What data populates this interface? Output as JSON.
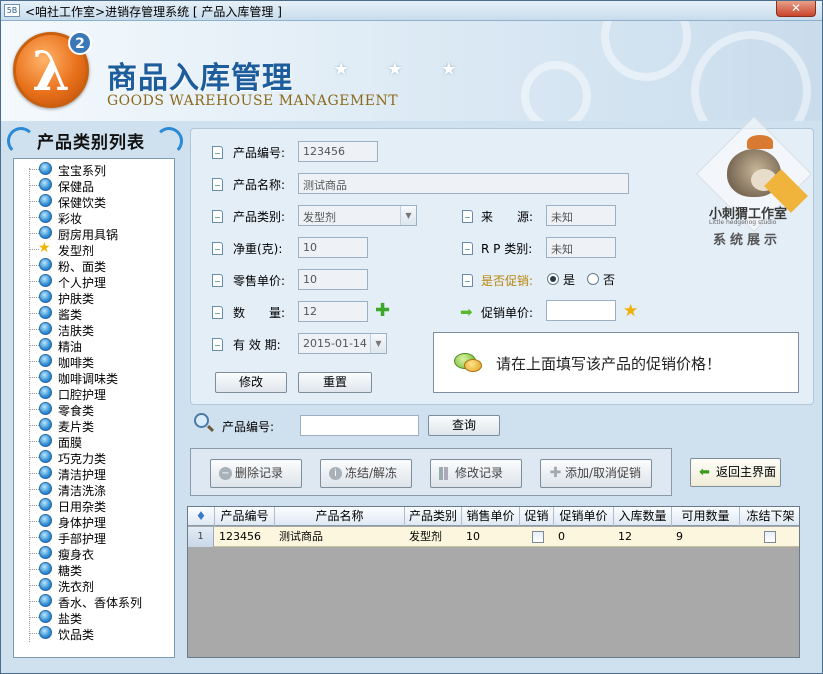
{
  "window": {
    "app_icon_text": "5B",
    "title": "<咱社工作室>进销存管理系统 [ 产品入库管理 ]",
    "close_label": "✕"
  },
  "header": {
    "logo_glyph": "λ",
    "logo_badge": "2",
    "title": "商品入库管理",
    "subtitle": "GOODS WAREHOUSE MANAGEMENT",
    "stars": "★ ★ ★"
  },
  "sidebar": {
    "title": "产品类别列表",
    "items": [
      {
        "label": "宝宝系列",
        "icon": "globe"
      },
      {
        "label": "保健品",
        "icon": "globe"
      },
      {
        "label": "保健饮类",
        "icon": "globe"
      },
      {
        "label": "彩妆",
        "icon": "globe"
      },
      {
        "label": "厨房用具锅",
        "icon": "globe"
      },
      {
        "label": "发型剂",
        "icon": "star"
      },
      {
        "label": "粉、面类",
        "icon": "globe"
      },
      {
        "label": "个人护理",
        "icon": "globe"
      },
      {
        "label": "护肤类",
        "icon": "globe"
      },
      {
        "label": "酱类",
        "icon": "globe"
      },
      {
        "label": "洁肤类",
        "icon": "globe"
      },
      {
        "label": "精油",
        "icon": "globe"
      },
      {
        "label": "咖啡类",
        "icon": "globe"
      },
      {
        "label": "咖啡调味类",
        "icon": "globe"
      },
      {
        "label": "口腔护理",
        "icon": "globe"
      },
      {
        "label": "零食类",
        "icon": "globe"
      },
      {
        "label": "麦片类",
        "icon": "globe"
      },
      {
        "label": "面膜",
        "icon": "globe"
      },
      {
        "label": "巧克力类",
        "icon": "globe"
      },
      {
        "label": "清洁护理",
        "icon": "globe"
      },
      {
        "label": "清洁洗涤",
        "icon": "globe"
      },
      {
        "label": "日用杂类",
        "icon": "globe"
      },
      {
        "label": "身体护理",
        "icon": "globe"
      },
      {
        "label": "手部护理",
        "icon": "globe"
      },
      {
        "label": "瘦身衣",
        "icon": "globe"
      },
      {
        "label": "糖类",
        "icon": "globe"
      },
      {
        "label": "洗衣剂",
        "icon": "globe"
      },
      {
        "label": "香水、香体系列",
        "icon": "globe"
      },
      {
        "label": "盐类",
        "icon": "globe"
      },
      {
        "label": "饮品类",
        "icon": "globe"
      }
    ]
  },
  "form": {
    "product_code_label": "产品编号:",
    "product_code_value": "123456",
    "product_name_label": "产品名称:",
    "product_name_value": "测试商品",
    "category_label": "产品类别:",
    "category_value": "发型剂",
    "source_label": "来　　源:",
    "source_value": "未知",
    "weight_label": "净重(克):",
    "weight_value": "10",
    "rp_label": "R P 类别:",
    "rp_value": "未知",
    "retail_price_label": "零售单价:",
    "retail_price_value": "10",
    "promo_label": "是否促销:",
    "promo_yes": "是",
    "promo_no": "否",
    "quantity_label": "数　　量:",
    "quantity_value": "12",
    "promo_price_label": "促销单价:",
    "promo_price_value": "",
    "expiry_label": "有 效 期:",
    "expiry_value": "2015-01-14",
    "modify_button": "修改",
    "reset_button": "重置",
    "hint_text": "请在上面填写该产品的促销价格！",
    "colors": {
      "promo_label": "#b8860b",
      "accent": "#2f8fd8"
    }
  },
  "brand": {
    "name": "小刺猬工作室",
    "english": "Little hedgehog studio",
    "tagline": "系统展示"
  },
  "search": {
    "label": "产品编号:",
    "value": "",
    "button": "查询"
  },
  "toolbar": {
    "delete": "删除记录",
    "freeze": "冻结/解冻",
    "edit": "修改记录",
    "promo": "添加/取消促销",
    "back": "返回主界面"
  },
  "grid": {
    "columns": [
      "产品编号",
      "产品名称",
      "产品类别",
      "销售单价",
      "促销",
      "促销单价",
      "入库数量",
      "可用数量",
      "冻结下架"
    ],
    "rows": [
      {
        "index": "1",
        "code": "123456",
        "name": "测试商品",
        "category": "发型剂",
        "price": "10",
        "promo": false,
        "promo_price": "0",
        "in_qty": "12",
        "avail_qty": "9",
        "frozen": false
      }
    ]
  }
}
